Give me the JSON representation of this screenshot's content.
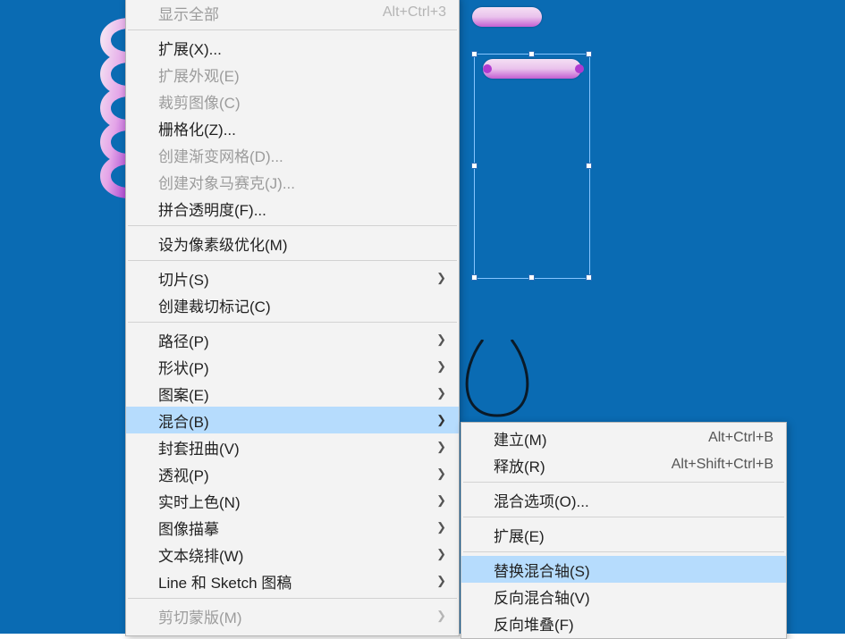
{
  "menu1": {
    "items": [
      {
        "label": "显示全部",
        "shortcut": "Alt+Ctrl+3",
        "disabled": true
      },
      {
        "separator": true
      },
      {
        "label": "扩展(X)..."
      },
      {
        "label": "扩展外观(E)",
        "disabled": true
      },
      {
        "label": "裁剪图像(C)",
        "disabled": true
      },
      {
        "label": "栅格化(Z)..."
      },
      {
        "label": "创建渐变网格(D)...",
        "disabled": true
      },
      {
        "label": "创建对象马赛克(J)...",
        "disabled": true
      },
      {
        "label": "拼合透明度(F)..."
      },
      {
        "separator": true
      },
      {
        "label": "设为像素级优化(M)"
      },
      {
        "separator": true
      },
      {
        "label": "切片(S)",
        "submenu": true
      },
      {
        "label": "创建裁切标记(C)"
      },
      {
        "separator": true
      },
      {
        "label": "路径(P)",
        "submenu": true
      },
      {
        "label": "形状(P)",
        "submenu": true
      },
      {
        "label": "图案(E)",
        "submenu": true
      },
      {
        "label": "混合(B)",
        "submenu": true,
        "highlight": true
      },
      {
        "label": "封套扭曲(V)",
        "submenu": true
      },
      {
        "label": "透视(P)",
        "submenu": true
      },
      {
        "label": "实时上色(N)",
        "submenu": true
      },
      {
        "label": "图像描摹",
        "submenu": true
      },
      {
        "label": "文本绕排(W)",
        "submenu": true
      },
      {
        "label": "Line 和 Sketch 图稿",
        "submenu": true
      },
      {
        "separator": true
      },
      {
        "label": "剪切蒙版(M)",
        "submenu": true,
        "disabled": true
      }
    ]
  },
  "menu2": {
    "items": [
      {
        "label": "建立(M)",
        "shortcut": "Alt+Ctrl+B"
      },
      {
        "label": "释放(R)",
        "shortcut": "Alt+Shift+Ctrl+B"
      },
      {
        "separator": true
      },
      {
        "label": "混合选项(O)..."
      },
      {
        "separator": true
      },
      {
        "label": "扩展(E)"
      },
      {
        "separator": true
      },
      {
        "label": "替换混合轴(S)",
        "highlight": true
      },
      {
        "label": "反向混合轴(V)"
      },
      {
        "label": "反向堆叠(F)"
      }
    ]
  }
}
